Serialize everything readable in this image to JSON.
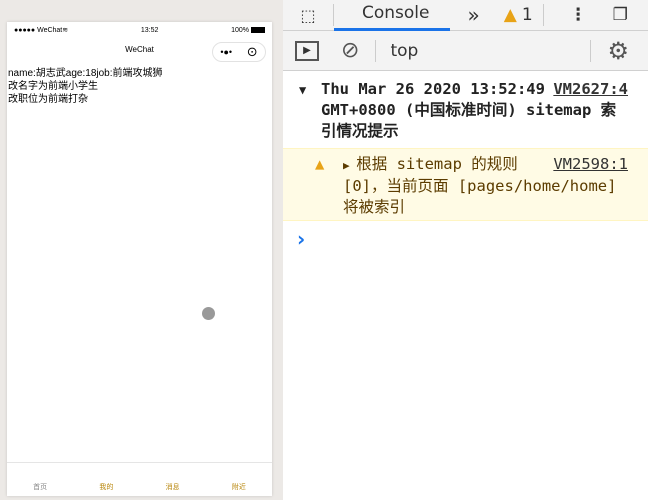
{
  "phone": {
    "status": {
      "carrier": "●●●●● WeChat",
      "wifi": "≋",
      "time": "13:52",
      "battery": "100%"
    },
    "nav_title": "WeChat",
    "capsule_more": "•●•",
    "capsule_close": "⊙",
    "lines": [
      "name:胡志武age:18job:前端攻城狮",
      "改名字为前端小学生",
      "改职位为前端打杂"
    ],
    "tabs": [
      "首页",
      "我的",
      "消息",
      "附近"
    ]
  },
  "devtools": {
    "tab_console": "Console",
    "more_tabs": "»",
    "warning_count": "1",
    "context": "top",
    "messages": [
      {
        "type": "info",
        "text": "Thu Mar 26 2020 13:52:49 GMT+0800 (中国标准时间) sitemap 索引情况提示",
        "source": "VM2627:4"
      },
      {
        "type": "warning",
        "text": "根据 sitemap 的规则[0]，当前页面 [pages/home/home] 将被索引",
        "source": "VM2598:1"
      }
    ],
    "prompt": "›"
  },
  "colors": {
    "accent": "#1a73e8",
    "warning": "#e8a317",
    "tab_active": "#b8860b"
  }
}
